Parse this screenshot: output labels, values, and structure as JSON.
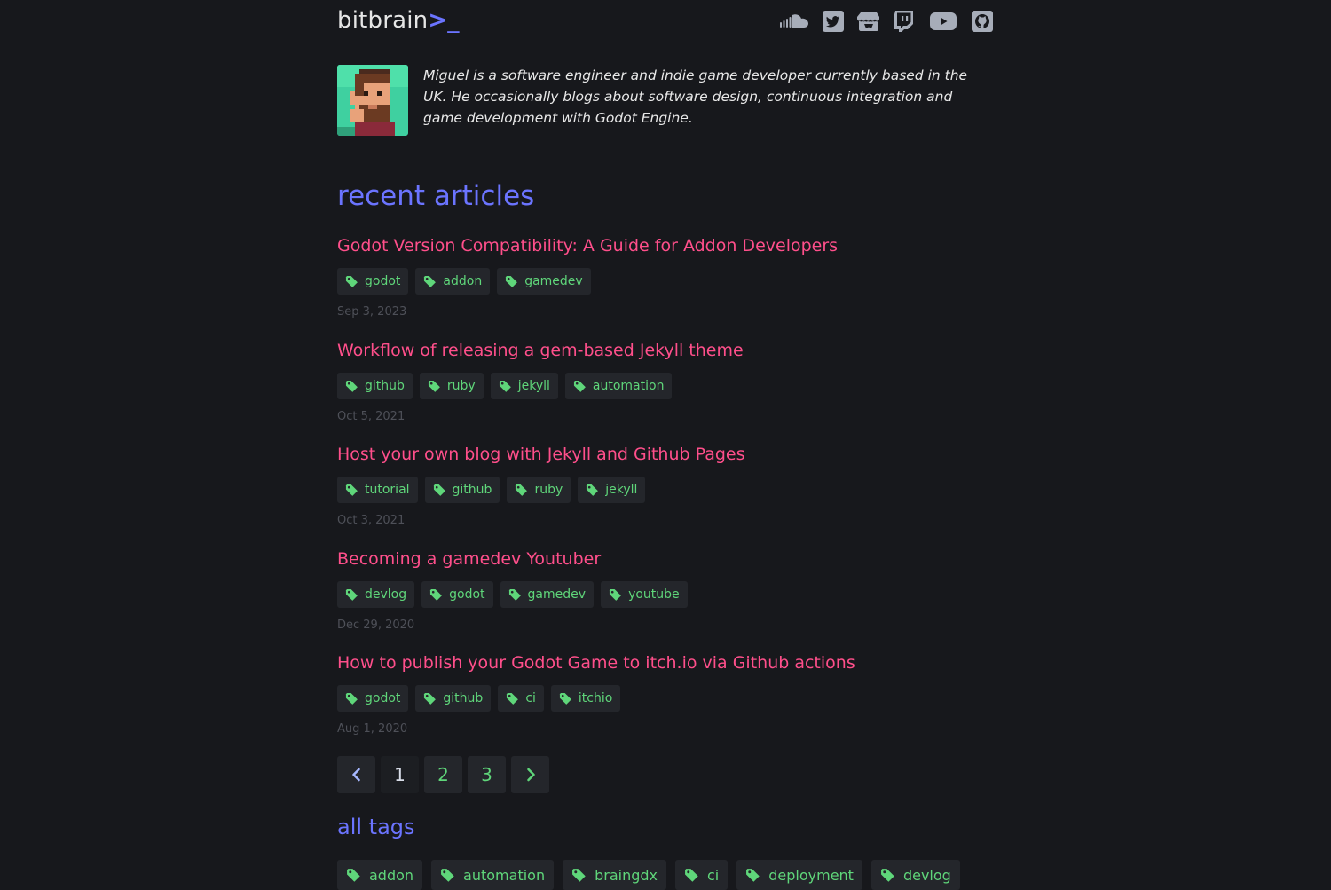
{
  "site": {
    "logo_text": "bitbrain",
    "logo_chevron": ">",
    "logo_cursor": "_"
  },
  "social": [
    {
      "icon": "soundcloud-icon"
    },
    {
      "icon": "twitter-icon"
    },
    {
      "icon": "itchio-icon"
    },
    {
      "icon": "twitch-icon"
    },
    {
      "icon": "youtube-icon"
    },
    {
      "icon": "github-icon"
    }
  ],
  "bio": {
    "text": "Miguel is a software engineer and indie game developer currently based in the UK. He occasionally blogs about software design, continuous integration and game development with Godot Engine."
  },
  "recent": {
    "heading": "recent articles",
    "articles": [
      {
        "title": "Godot Version Compatibility: A Guide for Addon Developers",
        "tags": [
          "godot",
          "addon",
          "gamedev"
        ],
        "date": "Sep 3, 2023"
      },
      {
        "title": "Workflow of releasing a gem-based Jekyll theme",
        "tags": [
          "github",
          "ruby",
          "jekyll",
          "automation"
        ],
        "date": "Oct 5, 2021"
      },
      {
        "title": "Host your own blog with Jekyll and Github Pages",
        "tags": [
          "tutorial",
          "github",
          "ruby",
          "jekyll"
        ],
        "date": "Oct 3, 2021"
      },
      {
        "title": "Becoming a gamedev Youtuber",
        "tags": [
          "devlog",
          "godot",
          "gamedev",
          "youtube"
        ],
        "date": "Dec 29, 2020"
      },
      {
        "title": "How to publish your Godot Game to itch.io via Github actions",
        "tags": [
          "godot",
          "github",
          "ci",
          "itchio"
        ],
        "date": "Aug 1, 2020"
      }
    ]
  },
  "pagination": {
    "pages": [
      "1",
      "2",
      "3"
    ],
    "current": "1"
  },
  "all_tags": {
    "heading": "all tags",
    "tags": [
      "addon",
      "automation",
      "braingdx",
      "ci",
      "deployment",
      "devlog"
    ]
  },
  "colors": {
    "background": "#17181c",
    "accent": "#6b74ff",
    "title": "#ff4f8b",
    "tag_text": "#5fd67a",
    "tag_bg": "#24262b",
    "date": "#4e5058"
  }
}
